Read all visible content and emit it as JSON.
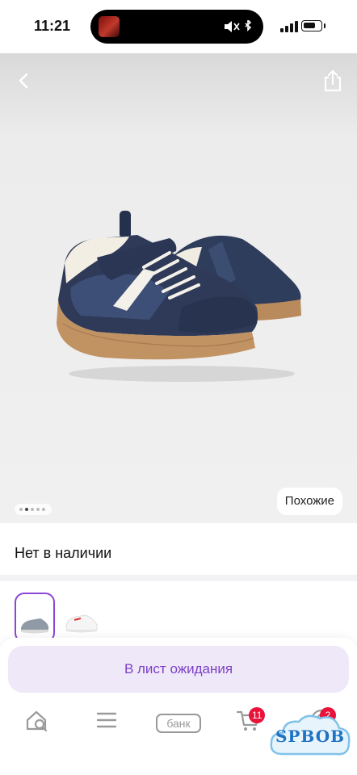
{
  "status_bar": {
    "time": "11:21"
  },
  "gallery": {
    "similar_label": "Похожие",
    "image_count": 5,
    "current_image": 2
  },
  "product": {
    "availability": "Нет в наличии"
  },
  "actions": {
    "waitlist_label": "В лист ожидания"
  },
  "tabbar": {
    "items": [
      {
        "name": "home-search",
        "icon": "home-search-icon"
      },
      {
        "name": "catalog",
        "icon": "menu-icon"
      },
      {
        "name": "bank",
        "label": "банк"
      },
      {
        "name": "cart",
        "icon": "cart-icon",
        "badge": "11"
      },
      {
        "name": "profile",
        "icon": "profile-icon",
        "badge": "2"
      }
    ]
  },
  "watermark": {
    "text": "SPBOB"
  },
  "colors": {
    "accent": "#8b46d6",
    "accent_text": "#7b3fc7",
    "badge": "#e8123a"
  }
}
